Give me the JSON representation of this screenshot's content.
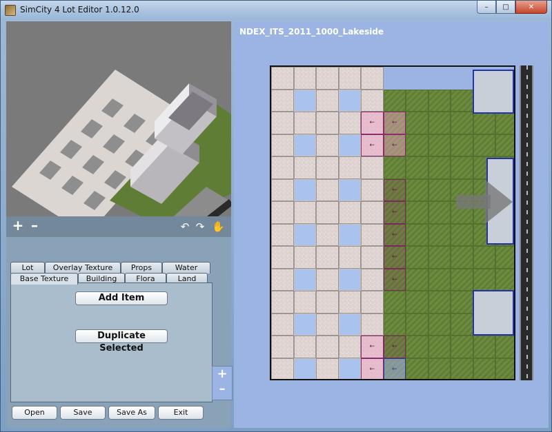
{
  "window": {
    "title": "SimCity 4 Lot Editor 1.0.12.0",
    "minimize": "–",
    "maximize": "□",
    "close": "✕"
  },
  "toolbar": {
    "zoom_in": "+",
    "zoom_out": "–",
    "rotate_left": "↶",
    "rotate_right": "↷",
    "hand": "✋"
  },
  "tabs": {
    "row1": [
      "Lot",
      "Overlay Texture",
      "Props",
      "Water"
    ],
    "row2": [
      "Base Texture",
      "Building",
      "Flora",
      "Land"
    ],
    "active": "Base Texture"
  },
  "tab_content": {
    "add_item": "Add Item",
    "duplicate_selected": "Duplicate Selected"
  },
  "bottom_buttons": {
    "open": "Open",
    "save": "Save",
    "save_as": "Save As",
    "exit": "Exit"
  },
  "lot": {
    "name": "NDEX_ITS_2011_1000_Lakeside",
    "zoom_in": "+",
    "zoom_out": "–"
  },
  "colors": {
    "tile": "#ddd2cf",
    "grass": "#6d8b3f",
    "highlight_pink": "#f0a0c8",
    "highlight_blue": "#2d3d9a"
  }
}
